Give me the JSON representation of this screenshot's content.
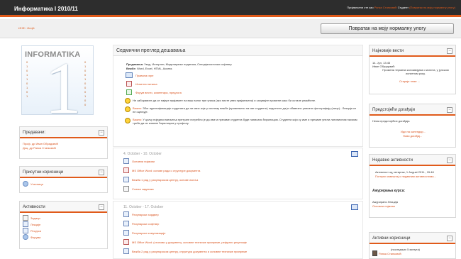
{
  "header": {
    "title": "Информатика I 2010/11",
    "login_prefix": "Пријављени сте као",
    "login_user": "Ранка Станковић",
    "login_role_text": "Студент",
    "login_role_link": "(Повратак на моју нормалну улогу)"
  },
  "breadcrumb": "ИНФ › Инф1",
  "role_button": "Повратак на моју нормалну улогу",
  "logo": {
    "word": "INFORMATIKA",
    "glyph": "1",
    "bits_left": "0 1 0 1 1 0 1 0 1",
    "bits_right": "0 1 0 0 1 0 0 0 1 0 0"
  },
  "left": {
    "teachers": {
      "title": "Предавачи:",
      "names": [
        "Проф. др Иван Обрадовић",
        "Доц. др Ранка Станковић"
      ]
    },
    "online_users": {
      "title": "Присутни корисници",
      "items": [
        "Учесници"
      ]
    },
    "activities": {
      "title": "Активности",
      "items": [
        "Задаци",
        "Лекције",
        "Ресурси",
        "Форуми"
      ]
    }
  },
  "center": {
    "weekly_title": "Седмични преглед дешавања",
    "topics_label": "Предавања:",
    "topics_text": "Увод, Интернет, Моделирање података, Специјалистички софтвер",
    "exercises_label": "Вежбе:",
    "exercises_text": "Word, Excel, HTML, Access",
    "links": [
      "Правила игре",
      "Испитна питања",
      "Форум вести, коментара, предлога"
    ],
    "notice1": "Не заборавите да се најпре пријавите на ваш налог пре уписа (ако нисте увек пријављени) и сачувајте промене како би остале упамћене.",
    "notice2_label": "Важно:",
    "notice2": "Због идентификације студената да ли свих које у систему вежбе (примењено на све студенте) подсетите да је обавезно уписати фотографију (лице) - Лекција се не оцењује.",
    "notice3_label": "Важно:",
    "notice3": "У циљу поједностављења претраге потребно је да име и презиме студента буде написано ћирилицом. Студенти који су име и презиме унели латиничним писмом треба да их измене ћирилицом у профилу.",
    "week1": {
      "title": "4. October - 10. October",
      "items": [
        "Основни појмови",
        "MS Office Word: основе рада с структуре документа",
        "Вежба 1 рад у рачунарском центру, основе word-a",
        "Слање задатака"
      ]
    },
    "week2": {
      "title": "11. October - 17. October",
      "items": [
        "Рачунарски хардвер",
        "Рачунарски софтвер",
        "Рачунарске комуникације",
        "MS Office Word: (стилови у документу, основне техничке припреме, рефрати рецензије",
        "Вежба 2 рад у рачунарском центру, структура документа и основне техничке припреме"
      ]
    }
  },
  "right": {
    "news": {
      "title": "Најновије вести",
      "date": "14. Јул, 13:45",
      "author": "Иван Обрадовић",
      "text": "Промена термина колоквијума и испита, у јулском испитном року.",
      "more": "Старије теме ..."
    },
    "upcoming": {
      "title": "Предстојећи догађаји",
      "none": "Нема предстојећих догађаја",
      "calendar": "Иди на календар...",
      "new_event": "Нови догађај..."
    },
    "recent": {
      "title": "Недавне активности",
      "since": "Активност од четвртак, 1 August 2011., 15:48",
      "full": "Потпуни извештај о недавним активностима...",
      "updates": "Ажурирања курса:",
      "updated_label": "Ажурирано Лекција",
      "updated_item": "Основни појмови"
    },
    "active_users": {
      "title": "Активни корисници",
      "period": "(последњих 5 минута)",
      "user": "Ранка Станковић"
    }
  },
  "colors": {
    "accent": "#e05a1a",
    "link": "#d9531e"
  }
}
